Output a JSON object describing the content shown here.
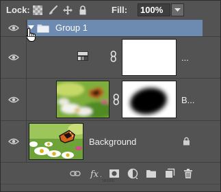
{
  "lock_bar": {
    "lock_label": "Lock:",
    "fill_label": "Fill:",
    "fill_value": "100%"
  },
  "layers": [
    {
      "name": "Group 1",
      "type": "group",
      "selected": true,
      "expanded": true
    },
    {
      "name": "...",
      "type": "adjustment-with-mask"
    },
    {
      "name": "B...",
      "type": "smart-image-with-mask"
    },
    {
      "name": "Background",
      "type": "background",
      "locked": true
    }
  ],
  "colors": {
    "panel": "#535353",
    "selection": "#6d8bb1",
    "text": "#eeeeee"
  },
  "icons": {
    "lock_bar": [
      "lock-transparent-pixels-icon",
      "lock-image-pixels-icon",
      "lock-position-icon",
      "lock-all-icon"
    ],
    "bottom_bar": [
      "link-layers-icon",
      "layer-style-fx-icon",
      "add-mask-icon",
      "adjustment-layer-icon",
      "new-group-icon",
      "new-layer-icon",
      "delete-layer-icon"
    ]
  }
}
